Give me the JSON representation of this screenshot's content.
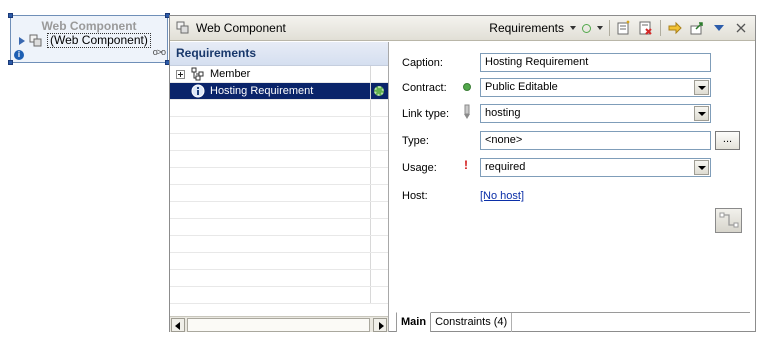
{
  "diagram_node": {
    "title": "Web Component",
    "label": "(Web Component)"
  },
  "view": {
    "title": "Web Component",
    "filter_label": "Requirements"
  },
  "requirements_list": {
    "header": "Requirements",
    "items": [
      {
        "label": "Member",
        "icon": "member-tree-icon",
        "expandable": true,
        "selected": false
      },
      {
        "label": "Hosting Requirement",
        "icon": "info-icon",
        "expandable": false,
        "selected": true
      }
    ]
  },
  "form": {
    "caption": {
      "label": "Caption:",
      "value": "Hosting Requirement"
    },
    "contract": {
      "label": "Contract:",
      "value": "Public Editable"
    },
    "link_type": {
      "label": "Link type:",
      "value": "hosting"
    },
    "type": {
      "label": "Type:",
      "value": "<none>",
      "browse_label": "..."
    },
    "usage": {
      "label": "Usage:",
      "value": "required",
      "indicator": "!"
    },
    "host": {
      "label": "Host:",
      "value": "[No host]"
    }
  },
  "tabs": [
    {
      "label": "Main",
      "active": true
    },
    {
      "label": "Constraints (4)",
      "active": false
    }
  ],
  "colors": {
    "selection": "#0a246a",
    "contract_dot": "#52a84b",
    "usage_required": "#d21919",
    "link": "#0b2fa8"
  }
}
